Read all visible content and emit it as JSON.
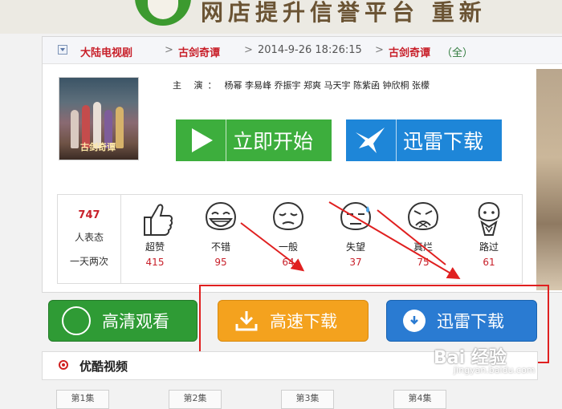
{
  "banner": {
    "text": "网店提升信誉平台 重新"
  },
  "breadcrumb": {
    "category": "大陆电视剧",
    "show": "古剑奇谭",
    "date": "2014-9-26 18:26:15",
    "show_full": "古剑奇谭",
    "year": "（全）",
    "sep": ">"
  },
  "poster": {
    "caption": "古剑奇谭"
  },
  "cast": {
    "label": "主 演：",
    "names": "杨幂 李易峰 乔振宇 郑爽 马天宇 陈紫函 钟欣桐 张檬"
  },
  "buttons": {
    "start": "立即开始",
    "thunder_top": "迅雷下载",
    "hd": "高清观看",
    "fast": "高速下载",
    "thunder_bottom": "迅雷下载"
  },
  "ratings": {
    "total": "747",
    "line1": "人表态",
    "line2": "一天两次",
    "items": [
      {
        "label": "超赞",
        "count": "415",
        "icon": "thumbs-up-icon"
      },
      {
        "label": "不错",
        "count": "95",
        "icon": "laughing-face-icon"
      },
      {
        "label": "一般",
        "count": "64",
        "icon": "meh-face-icon"
      },
      {
        "label": "失望",
        "count": "37",
        "icon": "sweat-face-icon"
      },
      {
        "label": "真烂",
        "count": "75",
        "icon": "angry-face-icon"
      },
      {
        "label": "路过",
        "count": "61",
        "icon": "passerby-face-icon"
      }
    ]
  },
  "youku": {
    "title": "优酷视频"
  },
  "episodes": [
    "第1集",
    "第2集",
    "第3集",
    "第4集"
  ],
  "watermark": {
    "main": "Bai 经验",
    "sub": "jingyan.baidu.com"
  },
  "colors": {
    "accent_red": "#c8202a",
    "green": "#3dae3d",
    "blue": "#1e86d8",
    "orange": "#f4a21e",
    "highlight": "#e02020"
  }
}
